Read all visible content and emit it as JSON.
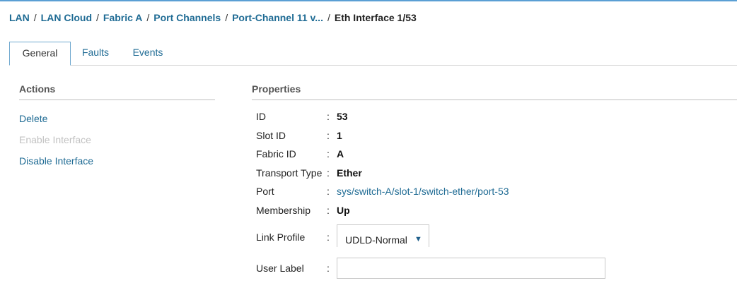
{
  "breadcrumb": {
    "items": [
      "LAN",
      "LAN Cloud",
      "Fabric A",
      "Port Channels",
      "Port-Channel 11 v..."
    ],
    "separator": "/",
    "current": "Eth Interface 1/53"
  },
  "tabs": [
    {
      "label": "General",
      "active": true
    },
    {
      "label": "Faults",
      "active": false
    },
    {
      "label": "Events",
      "active": false
    }
  ],
  "actions": {
    "title": "Actions",
    "items": [
      {
        "label": "Delete",
        "enabled": true
      },
      {
        "label": "Enable Interface",
        "enabled": false
      },
      {
        "label": "Disable Interface",
        "enabled": true
      }
    ]
  },
  "properties": {
    "title": "Properties",
    "separator": ":",
    "fields": [
      {
        "label": "ID",
        "value": "53"
      },
      {
        "label": "Slot ID",
        "value": "1"
      },
      {
        "label": "Fabric ID",
        "value": "A"
      },
      {
        "label": "Transport Type",
        "value": "Ether"
      },
      {
        "label": "Port",
        "value": "sys/switch-A/slot-1/switch-ether/port-53"
      },
      {
        "label": "Membership",
        "value": "Up"
      }
    ],
    "link_profile": {
      "label": "Link Profile",
      "selected": "UDLD-Normal",
      "caret": "▼"
    },
    "user_label": {
      "label": "User Label",
      "value": "",
      "placeholder": ""
    }
  },
  "colors": {
    "link": "#1f6b94",
    "tab_border": "#6fa8cf",
    "disabled": "#c2c2c2"
  }
}
